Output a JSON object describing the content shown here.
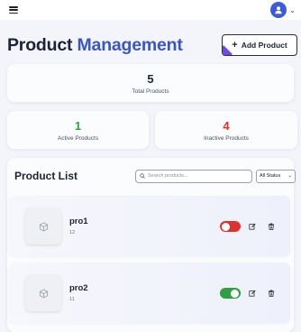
{
  "header": {
    "title_part1": "Product",
    "title_part2": "Management",
    "add_button_label": "Add Product"
  },
  "stats": {
    "total": {
      "value": "5",
      "label": "Total Products",
      "color": "#1c2333"
    },
    "active": {
      "value": "1",
      "label": "Active Products",
      "color": "#2f9e44"
    },
    "inactive": {
      "value": "4",
      "label": "Inactive Products",
      "color": "#e03131"
    }
  },
  "product_list": {
    "title": "Product List",
    "search_placeholder": "Search products...",
    "filter_value": "All Status",
    "items": [
      {
        "name": "pro1",
        "quantity": "12",
        "active": false
      },
      {
        "name": "pro2",
        "quantity": "11",
        "active": true
      }
    ]
  },
  "icons": {
    "menu": "hamburger-icon",
    "user": "user-icon",
    "dropdown": "chevron-down-icon",
    "search": "search-icon",
    "product": "box-icon",
    "edit": "edit-icon",
    "delete": "trash-icon"
  },
  "colors": {
    "accent": "#3a56c5",
    "avatar": "#3b5bdb",
    "active": "#2f9e44",
    "inactive": "#e03131"
  }
}
